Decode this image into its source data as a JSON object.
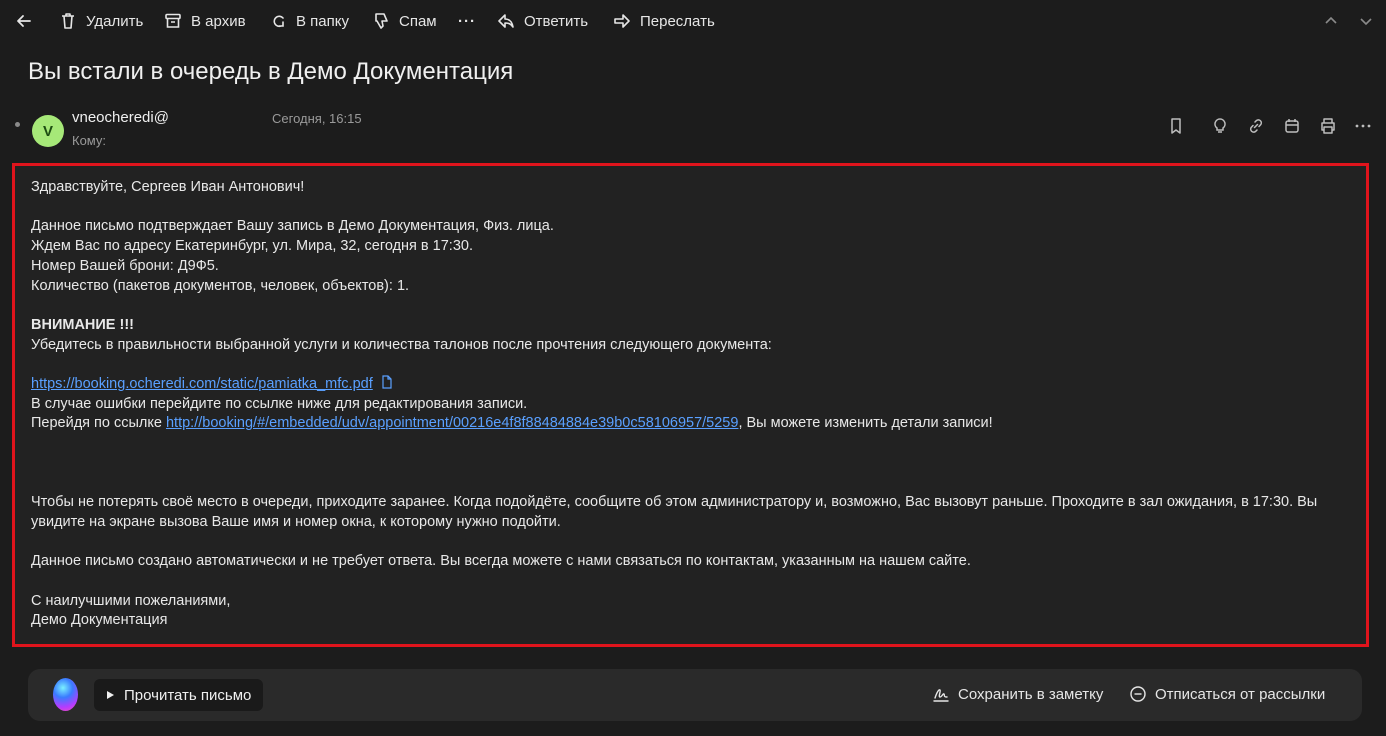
{
  "toolbar": {
    "back_icon": "arrow-left-icon",
    "delete": "Удалить",
    "archive": "В архив",
    "folder": "В папку",
    "spam": "Спам",
    "more": "···",
    "reply": "Ответить",
    "forward": "Переслать"
  },
  "message": {
    "subject": "Вы встали в очередь в Демо Документация",
    "avatar_letter": "V",
    "avatar_color": "#a6e878",
    "sender": "vneocheredi@",
    "to_label": "Кому:",
    "date": "Сегодня, 16:15"
  },
  "body": {
    "greeting": "Здравствуйте, Сергеев Иван Антонович!",
    "line1": "Данное письмо подтверждает Вашу запись в Демо Документация, Физ. лица.",
    "line2": "Ждем Вас по адресу Екатеринбург, ул. Мира, 32, сегодня в 17:30.",
    "line3": "Номер Вашей брони: Д9Ф5.",
    "line4": "Количество (пакетов документов, человек, объектов): 1.",
    "attention": "ВНИМАНИЕ !!!",
    "check": "Убедитесь в правильности выбранной услуги и количества талонов после прочтения следующего документа:",
    "pdf_link": "https://booking.ocheredi.com/static/pamiatka_mfc.pdf",
    "error_line": "В случае ошибки перейдите по ссылке ниже для редактирования записи.",
    "edit_prefix": "Перейдя по ссылке ",
    "edit_link": "http://booking/#/embedded/udv/appointment/00216e4f8f88484884e39b0c58106957/5259",
    "edit_suffix": ", Вы можете изменить детали записи!",
    "advice": "Чтобы не потерять своё место в очереди, приходите заранее. Когда подойдёте, сообщите об этом администратору и, возможно, Вас вызовут раньше. Проходите в зал ожидания, в 17:30. Вы увидите на экране вызова Ваше имя и номер окна, к которому нужно подойти.",
    "auto": "Данное письмо создано автоматически и не требует ответа. Вы всегда можете с нами связаться по контактам, указанным на нашем сайте.",
    "regards": "С наилучшими пожеланиями,",
    "signature": "Демо Документация"
  },
  "bottom": {
    "read_aloud": "Прочитать письмо",
    "save_note": "Сохранить в заметку",
    "unsubscribe": "Отписаться от рассылки"
  },
  "colors": {
    "background": "#1c1c1c",
    "highlight_border": "#e0141c",
    "link": "#5aa0ff"
  }
}
